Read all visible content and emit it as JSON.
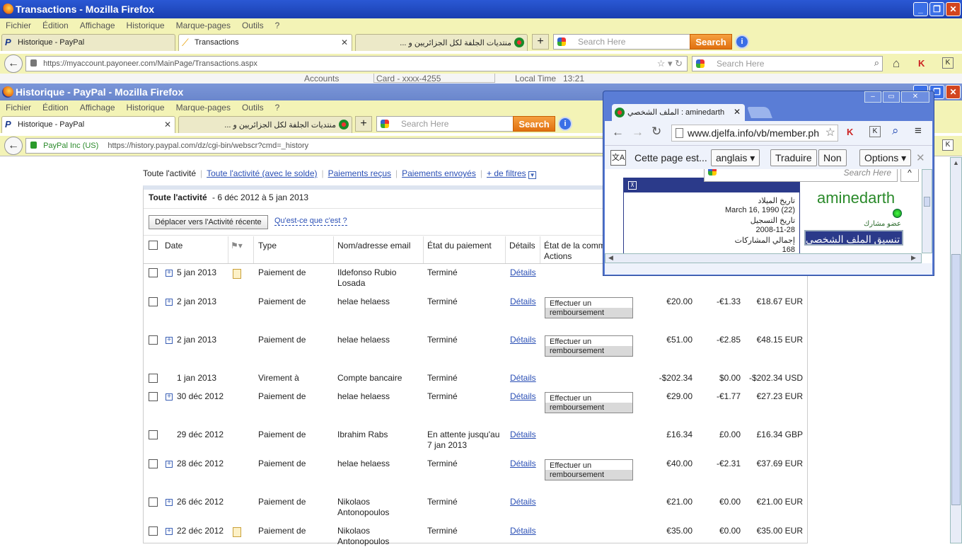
{
  "back_window": {
    "title": "Transactions - Mozilla Firefox",
    "menu": [
      "Fichier",
      "Édition",
      "Affichage",
      "Historique",
      "Marque-pages",
      "Outils",
      "?"
    ],
    "tabs": [
      {
        "label": "Historique - PayPal"
      },
      {
        "label": "Transactions"
      },
      {
        "label": "منتديات الجلفة لكل الجزائريين و ..."
      }
    ],
    "search_placeholder": "Search Here",
    "search_button": "Search",
    "url": "https://myaccount.payoneer.com/MainPage/Transactions.aspx",
    "nav_search_placeholder": "Search Here",
    "peek": {
      "accounts": "Accounts",
      "card": "Card - xxxx-4255",
      "local_time": "Local Time",
      "time_value": "13:21"
    }
  },
  "front_window": {
    "title": "Historique - PayPal - Mozilla Firefox",
    "menu": [
      "Fichier",
      "Édition",
      "Affichage",
      "Historique",
      "Marque-pages",
      "Outils",
      "?"
    ],
    "tabs": [
      {
        "label": "Historique - PayPal"
      },
      {
        "label": "منتديات الجلفة لكل الجزائريين و ..."
      }
    ],
    "search_placeholder": "Search Here",
    "search_button": "Search",
    "identity": "PayPal Inc (US)",
    "url": "https://history.paypal.com/dz/cgi-bin/webscr?cmd=_history"
  },
  "filters": {
    "all": "Toute l'activité",
    "all_balance": "Toute l'activité (avec le solde)",
    "received": "Paiements reçus",
    "sent": "Paiements envoyés",
    "more": "+ de filtres"
  },
  "panel": {
    "title": "Toute l'activité",
    "range": "- 6 déc 2012 à 5 jan 2013",
    "move_button": "Déplacer vers l'Activité récente",
    "what_link": "Qu'est-ce que c'est ?"
  },
  "columns": {
    "date": "Date",
    "type": "Type",
    "name": "Nom/adresse email",
    "status": "État du paiement",
    "details": "Détails",
    "order_status": "État de la comma",
    "actions": "Actions"
  },
  "refund_label": [
    "Effectuer un",
    "remboursement"
  ],
  "rows": [
    {
      "date": "5 jan 2013",
      "type": "Paiement de",
      "name": [
        "Ildefonso Rubio",
        "Losada"
      ],
      "status": [
        "Terminé"
      ],
      "details": "Détails",
      "gross": "",
      "fee": "",
      "net": ""
    },
    {
      "date": "2 jan 2013",
      "type": "Paiement de",
      "name": [
        "helae helaess"
      ],
      "status": [
        "Terminé"
      ],
      "details": "Détails",
      "gross": "€20.00",
      "fee": "-€1.33",
      "net": "€18.67 EUR"
    },
    {
      "date": "2 jan 2013",
      "type": "Paiement de",
      "name": [
        "helae helaess"
      ],
      "status": [
        "Terminé"
      ],
      "details": "Détails",
      "gross": "€51.00",
      "fee": "-€2.85",
      "net": "€48.15 EUR"
    },
    {
      "date": "1 jan 2013",
      "type": "Virement à",
      "name": [
        "Compte bancaire"
      ],
      "status": [
        "Terminé"
      ],
      "details": "Détails",
      "gross": "-$202.34",
      "fee": "$0.00",
      "net": "-$202.34 USD"
    },
    {
      "date": "30 déc 2012",
      "type": "Paiement de",
      "name": [
        "helae helaess"
      ],
      "status": [
        "Terminé"
      ],
      "details": "Détails",
      "gross": "€29.00",
      "fee": "-€1.77",
      "net": "€27.23 EUR"
    },
    {
      "date": "29 déc 2012",
      "type": "Paiement de",
      "name": [
        "Ibrahim Rabs"
      ],
      "status": [
        "En attente jusqu'au",
        "7 jan 2013"
      ],
      "details": "Détails",
      "gross": "£16.34",
      "fee": "£0.00",
      "net": "£16.34 GBP"
    },
    {
      "date": "28 déc 2012",
      "type": "Paiement de",
      "name": [
        "helae helaess"
      ],
      "status": [
        "Terminé"
      ],
      "details": "Détails",
      "gross": "€40.00",
      "fee": "-€2.31",
      "net": "€37.69 EUR"
    },
    {
      "date": "26 déc 2012",
      "type": "Paiement de",
      "name": [
        "Nikolaos",
        "Antonopoulos"
      ],
      "status": [
        "Terminé"
      ],
      "details": "Détails",
      "gross": "€21.00",
      "fee": "€0.00",
      "net": "€21.00 EUR"
    },
    {
      "date": "22 déc 2012",
      "type": "Paiement de",
      "name": [
        "Nikolaos",
        "Antonopoulos"
      ],
      "status": [
        "Terminé"
      ],
      "details": "Détails",
      "gross": "€35.00",
      "fee": "€0.00",
      "net": "€35.00 EUR"
    }
  ],
  "chrome_popup": {
    "tab_title": "الملف الشخصي : aminedarth",
    "url": "www.djelfa.info/vb/member.ph",
    "translate_text": "Cette page est...",
    "language": "anglais",
    "translate_button": "Traduire",
    "no_button": "Non",
    "options_button": "Options",
    "search_placeholder": "Search Here",
    "birthday_label": "تاريخ الميلاد",
    "birthday_value": "March 16, 1990 (22)",
    "registered_label": "تاريخ التسجيل",
    "registered_value": "2008-11-28",
    "posts_label": "إجمالي المشاركات",
    "posts_value": "168",
    "username": "aminedarth",
    "rank": "عضو مشارك",
    "profile_banner": "تنسيق الملف الشخصي"
  }
}
